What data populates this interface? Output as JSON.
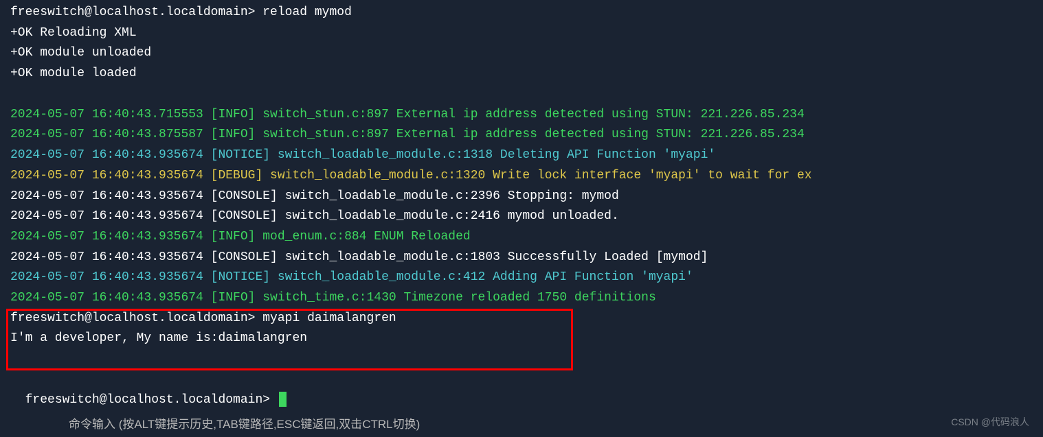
{
  "lines": {
    "l0": "freeswitch@localhost.localdomain> reload mymod",
    "l1": "+OK Reloading XML",
    "l2": "+OK module unloaded",
    "l3": "+OK module loaded",
    "l4": "2024-05-07 16:40:43.715553 [INFO] switch_stun.c:897 External ip address detected using STUN: 221.226.85.234",
    "l5": "2024-05-07 16:40:43.875587 [INFO] switch_stun.c:897 External ip address detected using STUN: 221.226.85.234",
    "l6": "2024-05-07 16:40:43.935674 [NOTICE] switch_loadable_module.c:1318 Deleting API Function 'myapi'",
    "l7": "2024-05-07 16:40:43.935674 [DEBUG] switch_loadable_module.c:1320 Write lock interface 'myapi' to wait for ex",
    "l8": "2024-05-07 16:40:43.935674 [CONSOLE] switch_loadable_module.c:2396 Stopping: mymod",
    "l9": "2024-05-07 16:40:43.935674 [CONSOLE] switch_loadable_module.c:2416 mymod unloaded.",
    "l10": "2024-05-07 16:40:43.935674 [INFO] mod_enum.c:884 ENUM Reloaded",
    "l11": "2024-05-07 16:40:43.935674 [CONSOLE] switch_loadable_module.c:1803 Successfully Loaded [mymod]",
    "l12": "2024-05-07 16:40:43.935674 [NOTICE] switch_loadable_module.c:412 Adding API Function 'myapi'",
    "l13": "2024-05-07 16:40:43.935674 [INFO] switch_time.c:1430 Timezone reloaded 1750 definitions",
    "l14": "freeswitch@localhost.localdomain> myapi daimalangren",
    "l15": "I'm a developer, My name is:daimalangren",
    "prompt": "freeswitch@localhost.localdomain> "
  },
  "footer": "命令输入 (按ALT键提示历史,TAB键路径,ESC键返回,双击CTRL切换)",
  "watermark": "CSDN @代码浪人"
}
